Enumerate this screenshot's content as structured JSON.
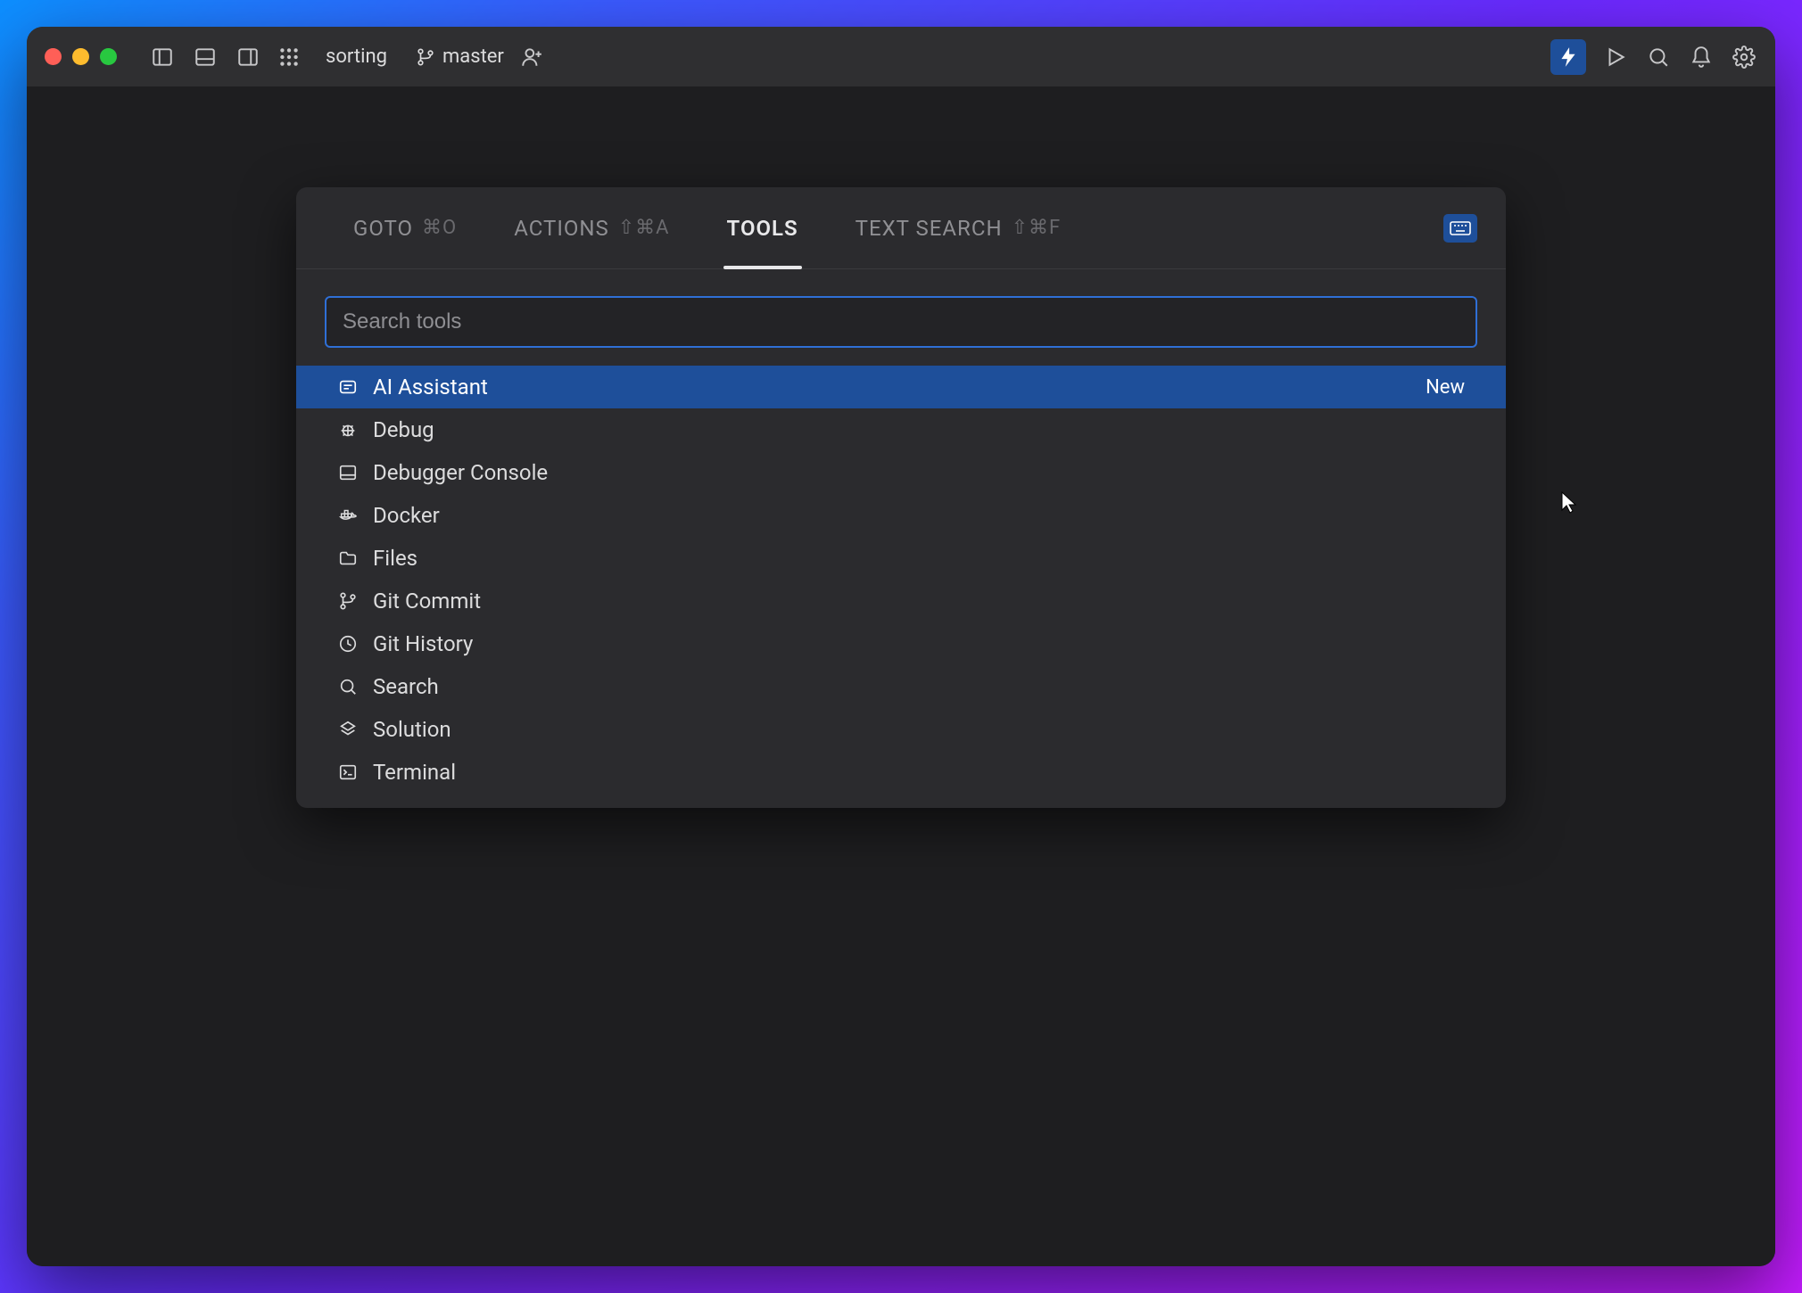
{
  "titlebar": {
    "project": "sorting",
    "branch": "master"
  },
  "palette": {
    "tabs": [
      {
        "label": "GOTO",
        "shortcut": "⌘O",
        "active": false
      },
      {
        "label": "ACTIONS",
        "shortcut": "⇧⌘A",
        "active": false
      },
      {
        "label": "TOOLS",
        "shortcut": "",
        "active": true
      },
      {
        "label": "TEXT SEARCH",
        "shortcut": "⇧⌘F",
        "active": false
      }
    ],
    "search_placeholder": "Search tools",
    "items": [
      {
        "icon": "ai",
        "label": "AI Assistant",
        "badge": "New",
        "selected": true
      },
      {
        "icon": "bug",
        "label": "Debug",
        "badge": "",
        "selected": false
      },
      {
        "icon": "console",
        "label": "Debugger Console",
        "badge": "",
        "selected": false
      },
      {
        "icon": "docker",
        "label": "Docker",
        "badge": "",
        "selected": false
      },
      {
        "icon": "folder",
        "label": "Files",
        "badge": "",
        "selected": false
      },
      {
        "icon": "commit",
        "label": "Git Commit",
        "badge": "",
        "selected": false
      },
      {
        "icon": "clock",
        "label": "Git History",
        "badge": "",
        "selected": false
      },
      {
        "icon": "search",
        "label": "Search",
        "badge": "",
        "selected": false
      },
      {
        "icon": "solution",
        "label": "Solution",
        "badge": "",
        "selected": false
      },
      {
        "icon": "terminal",
        "label": "Terminal",
        "badge": "",
        "selected": false
      }
    ]
  }
}
